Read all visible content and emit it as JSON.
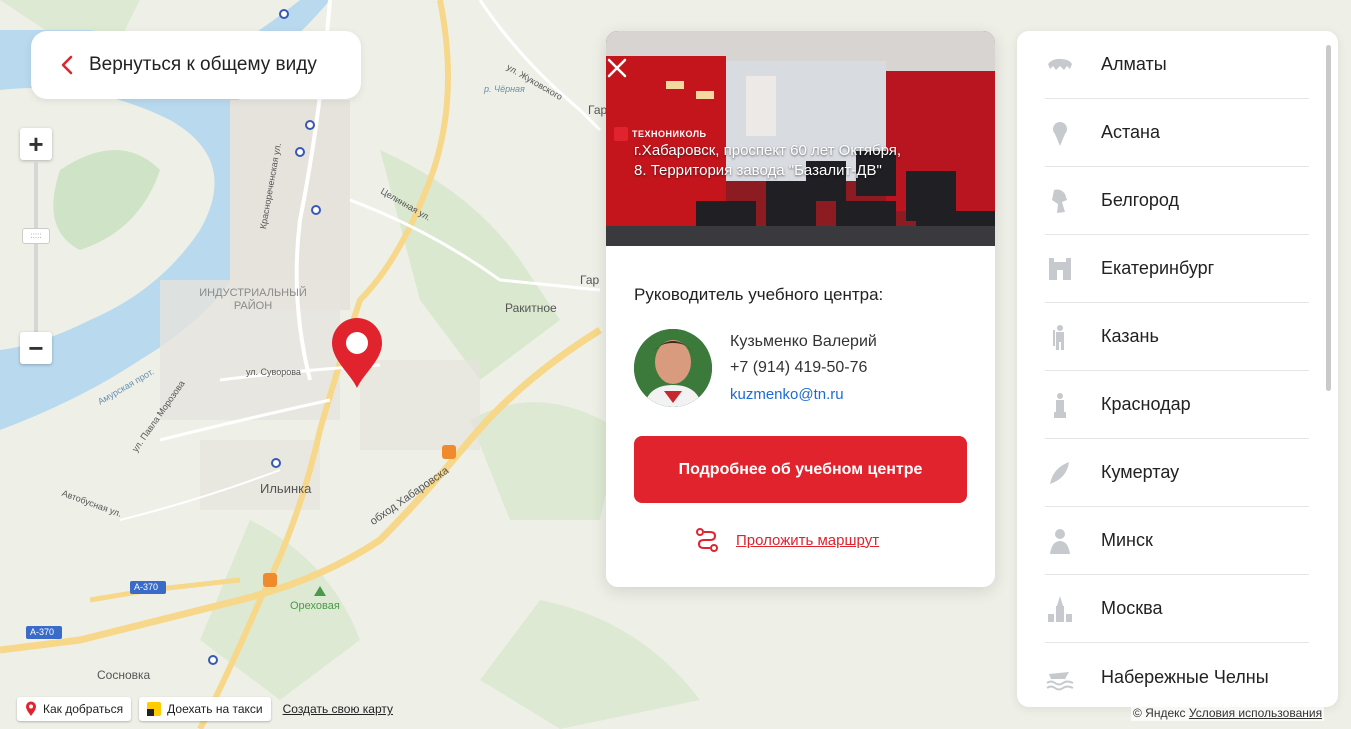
{
  "back_button": {
    "label": "Вернуться к общему виду"
  },
  "zoom": {
    "plus": "+",
    "minus": "−"
  },
  "map_labels": {
    "industrial_district": "ИНДУСТРИАЛЬНЫЙ РАЙОН",
    "rakitnoe": "Ракитное",
    "ilyinka": "Ильинка",
    "orekhovaya": "Ореховая",
    "sosnovka": "Сосновка",
    "a370_1": "А-370",
    "a370_2": "А-370",
    "obkhod": "обход Хабаровска",
    "suvorova": "ул. Суворова",
    "zhukovskogo": "ул. Жуковского",
    "amurskaya": "Амурская прот.",
    "pavla_morozova": "ул. Павла Морозова",
    "krasnorechenskaya": "Краснореченская ул.",
    "celinnaya": "Целинная ул.",
    "chyornaya": "р. Чёрная",
    "avtobusnaya": "Автобусная ул.",
    "chyornaya2": "Гар",
    "gar2": "Гар"
  },
  "popup": {
    "brand": "ТЕХНОНИКОЛЬ",
    "address": "г.Хабаровск, проспект 60 лет Октября, 8. Территория завода \"Базалит-ДВ\"",
    "title": "Руководитель учебного центра:",
    "contact_name": "Кузьменко Валерий",
    "contact_phone": "+7 (914) 419-50-76",
    "contact_email": "kuzmenko@tn.ru",
    "more_button": "Подробнее об учебном центре",
    "route_link": "Проложить маршрут"
  },
  "cities": [
    {
      "name": "Алматы",
      "icon": "snow-leopard-icon"
    },
    {
      "name": "Астана",
      "icon": "baiterek-icon"
    },
    {
      "name": "Белгород",
      "icon": "lion-crest-icon"
    },
    {
      "name": "Екатеринбург",
      "icon": "fortress-icon"
    },
    {
      "name": "Казань",
      "icon": "warrior-icon"
    },
    {
      "name": "Краснодар",
      "icon": "monument-icon"
    },
    {
      "name": "Кумертау",
      "icon": "leaf-emblem-icon"
    },
    {
      "name": "Минск",
      "icon": "monument-bust-icon"
    },
    {
      "name": "Москва",
      "icon": "kremlin-icon"
    },
    {
      "name": "Набережные Челны",
      "icon": "waves-boat-icon"
    }
  ],
  "bottom_bar": {
    "directions": "Как добраться",
    "taxi": "Доехать на такси",
    "create_map": "Создать свою карту"
  },
  "copyright": {
    "prefix": "© Яндекс",
    "terms": "Условия использования"
  },
  "colors": {
    "accent": "#e0232d",
    "link": "#1c6bd6",
    "river": "#b9d9ef",
    "road": "#f7d88a"
  }
}
